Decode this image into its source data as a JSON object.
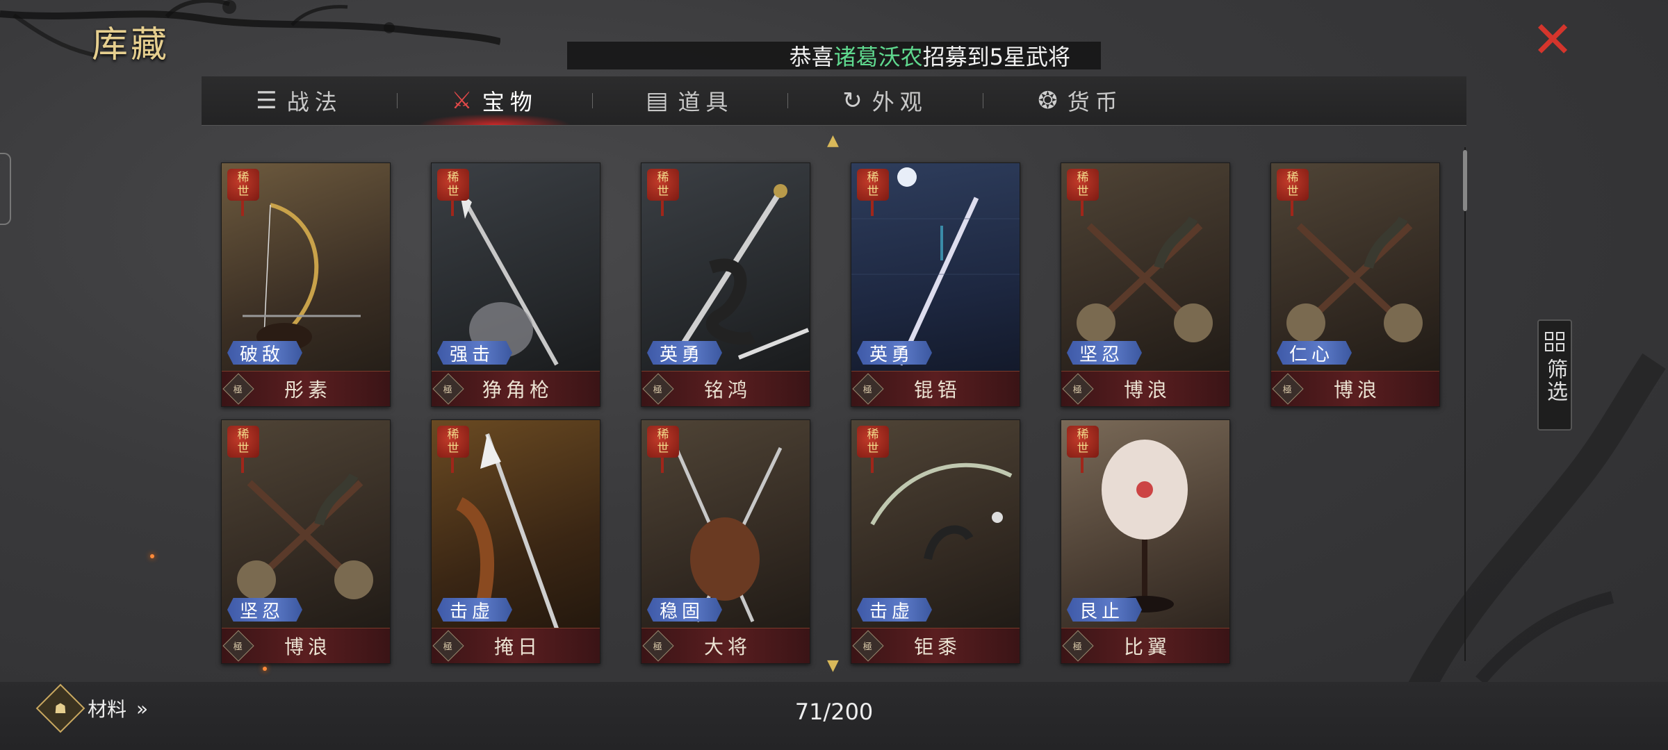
{
  "title": "库藏",
  "close_icon": "close-icon",
  "banner": {
    "prefix": "恭喜",
    "name": "诸葛沃农",
    "suffix": "招募到5星武将",
    "name_color": "#5fd88e"
  },
  "tabs": [
    {
      "label": "战法",
      "icon": "scroll-bundle-icon",
      "active": false
    },
    {
      "label": "宝物",
      "icon": "treasure-icon",
      "active": true
    },
    {
      "label": "道具",
      "icon": "box-icon",
      "active": false
    },
    {
      "label": "外观",
      "icon": "swirl-icon",
      "active": false
    },
    {
      "label": "货币",
      "icon": "money-bag-icon",
      "active": false
    }
  ],
  "filter": {
    "label": "筛选",
    "icon": "grid-filter-icon"
  },
  "items": [
    {
      "seal": "稀世",
      "trait": "破敌",
      "grade": "極",
      "name": "彤素",
      "art": "bow"
    },
    {
      "seal": "稀世",
      "trait": "强击",
      "grade": "極",
      "name": "狰角枪",
      "art": "spear"
    },
    {
      "seal": "稀世",
      "trait": "英勇",
      "grade": "極",
      "name": "铭鸿",
      "art": "sword-dragon"
    },
    {
      "seal": "稀世",
      "trait": "英勇",
      "grade": "極",
      "name": "锟铻",
      "art": "sword-moon"
    },
    {
      "seal": "稀世",
      "trait": "坚忍",
      "grade": "極",
      "name": "博浪",
      "art": "hammers"
    },
    {
      "seal": "稀世",
      "trait": "仁心",
      "grade": "極",
      "name": "博浪",
      "art": "hammers"
    },
    {
      "seal": "稀世",
      "trait": "坚忍",
      "grade": "極",
      "name": "博浪",
      "art": "hammers"
    },
    {
      "seal": "稀世",
      "trait": "击虚",
      "grade": "極",
      "name": "掩日",
      "art": "halberd"
    },
    {
      "seal": "稀世",
      "trait": "稳固",
      "grade": "極",
      "name": "大将",
      "art": "crossed-spears"
    },
    {
      "seal": "稀世",
      "trait": "击虚",
      "grade": "極",
      "name": "钜黍",
      "art": "bow-crane"
    },
    {
      "seal": "稀世",
      "trait": "艮止",
      "grade": "極",
      "name": "比翼",
      "art": "fan"
    }
  ],
  "footer": {
    "materials_label": "材料",
    "materials_arrow": "»",
    "count": "71/200"
  },
  "colors": {
    "accent_gold": "#e6cf8f",
    "close_red": "#d4352c",
    "trait_blue": "#4a66b4",
    "name_bar": "#4a181a"
  }
}
